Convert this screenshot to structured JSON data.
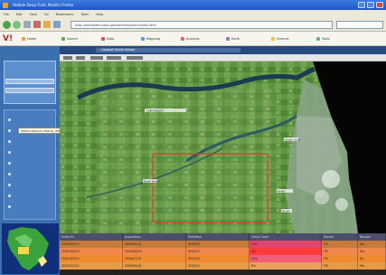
{
  "window": {
    "title": "Hubble Deep Field, Mozilla Firefox"
  },
  "menubar": [
    "File",
    "Edit",
    "View",
    "Go",
    "Bookmarks",
    "Tools",
    "Help"
  ],
  "navbar": {
    "address": "http://earthdata.nasa.gov/earthexplorer/index.html"
  },
  "bookmarks": [
    {
      "label": "Home",
      "color": "#e8a13a"
    },
    {
      "label": "Search",
      "color": "#6aa84f"
    },
    {
      "label": "Data",
      "color": "#c55"
    },
    {
      "label": "Mapping",
      "color": "#5b9bd5"
    },
    {
      "label": "Analysis",
      "color": "#e06666"
    },
    {
      "label": "Earth",
      "color": "#8e7cc3"
    },
    {
      "label": "Science",
      "color": "#f1c232"
    },
    {
      "label": "Tools",
      "color": "#76a5af"
    }
  ],
  "brand": {
    "logo_text": "V!"
  },
  "left_panel": {
    "tabs": [
      "Search",
      "Info"
    ],
    "tooltip": "Select search criteria, data sets, and results"
  },
  "map": {
    "toolbar_title": "Landsat Scene Viewer",
    "labels": [
      "Lake Region",
      "Urban Area",
      "River Delta",
      "North",
      "South"
    ]
  },
  "results": {
    "headers": [
      "Entity ID",
      "Acquisition",
      "Path/Row",
      "Cloud Cover",
      "Sensor",
      "Browse"
    ],
    "rows": [
      {
        "cells": [
          "LT50230312",
          "2009/05/12",
          "023/031",
          "12%",
          "TM",
          "Yes"
        ],
        "bg": "#c77b3a"
      },
      {
        "cells": [
          "LT50230313",
          "2009/06/13",
          "023/031",
          "4%",
          "TM",
          "Yes"
        ],
        "bg": "#f2874b"
      },
      {
        "cells": [
          "LT50230314",
          "2009/07/15",
          "023/031",
          "30%",
          "TM",
          "No"
        ],
        "bg": "#f08a2e"
      },
      {
        "cells": [
          "LT50230315",
          "2009/08/16",
          "023/031",
          "8%",
          "TM",
          "Yes"
        ],
        "bg": "#e79a45"
      }
    ]
  },
  "colors": {
    "accent": "#3c6fb0",
    "highlight": "#ff3b3b"
  }
}
